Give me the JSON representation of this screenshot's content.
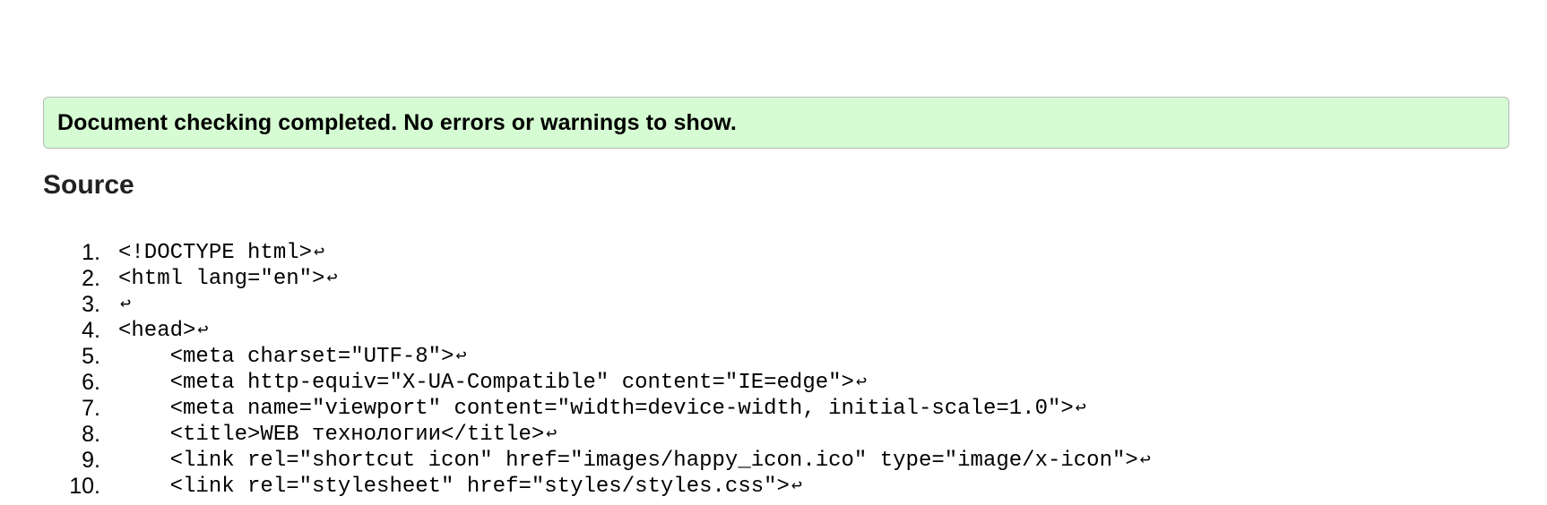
{
  "status": {
    "message": "Document checking completed. No errors or warnings to show.",
    "color": "#d5fcd2"
  },
  "source": {
    "heading": "Source",
    "line_end_glyph": "↩",
    "lines": [
      {
        "number": "1.",
        "code": "<!DOCTYPE html>"
      },
      {
        "number": "2.",
        "code": "<html lang=\"en\">"
      },
      {
        "number": "3.",
        "code": ""
      },
      {
        "number": "4.",
        "code": "<head>"
      },
      {
        "number": "5.",
        "code": "    <meta charset=\"UTF-8\">"
      },
      {
        "number": "6.",
        "code": "    <meta http-equiv=\"X-UA-Compatible\" content=\"IE=edge\">"
      },
      {
        "number": "7.",
        "code": "    <meta name=\"viewport\" content=\"width=device-width, initial-scale=1.0\">"
      },
      {
        "number": "8.",
        "code": "    <title>WEB технологии</title>"
      },
      {
        "number": "9.",
        "code": "    <link rel=\"shortcut icon\" href=\"images/happy_icon.ico\" type=\"image/x-icon\">"
      },
      {
        "number": "10.",
        "code": "    <link rel=\"stylesheet\" href=\"styles/styles.css\">"
      }
    ]
  }
}
